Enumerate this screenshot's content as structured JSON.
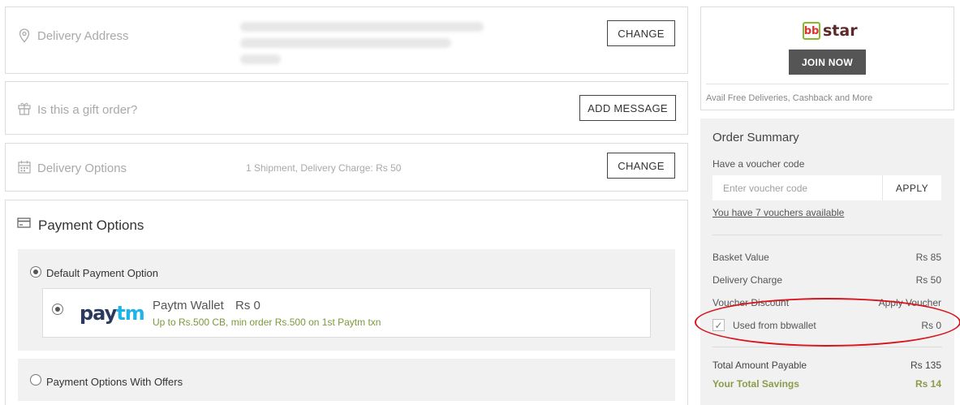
{
  "delivery_address": {
    "title": "Delivery Address",
    "change_label": "CHANGE"
  },
  "gift": {
    "title": "Is this a gift order?",
    "add_message_label": "ADD MESSAGE"
  },
  "delivery_options": {
    "title": "Delivery Options",
    "info": "1 Shipment, Delivery Charge: Rs 50",
    "change_label": "CHANGE"
  },
  "payment": {
    "title": "Payment Options",
    "default_option": {
      "label": "Default Payment Option",
      "selected": true,
      "wallet": {
        "logo_text_left": "pay",
        "logo_text_right": "tm",
        "name": "Paytm Wallet",
        "amount": "Rs 0",
        "offer": "Up to Rs.500 CB, min order Rs.500 on 1st Paytm txn"
      }
    },
    "offers_option": {
      "label": "Payment Options With Offers",
      "selected": false
    }
  },
  "bbstar": {
    "logo_mark": "bb",
    "logo_word": "star",
    "join_label": "JOIN NOW",
    "note": "Avail Free Deliveries, Cashback and More"
  },
  "summary": {
    "title": "Order Summary",
    "voucher_prompt": "Have a voucher code",
    "voucher_placeholder": "Enter voucher code",
    "apply_label": "APPLY",
    "vouchers_available": "You have 7 vouchers available",
    "rows": [
      {
        "label": "Basket Value",
        "value": "Rs 85"
      },
      {
        "label": "Delivery Charge",
        "value": "Rs 50"
      },
      {
        "label": "Voucher Discount",
        "value": "Apply Voucher"
      }
    ],
    "bbwallet": {
      "label": "Used from bbwallet",
      "value": "Rs 0",
      "checked": true
    },
    "total": {
      "label": "Total Amount Payable",
      "value": "Rs 135"
    },
    "savings": {
      "label": "Your Total Savings",
      "value": "Rs 14"
    }
  },
  "colors": {
    "accent_green": "#84bb2a",
    "highlight_red": "#d8141c",
    "savings_green": "#8a9c4a"
  }
}
